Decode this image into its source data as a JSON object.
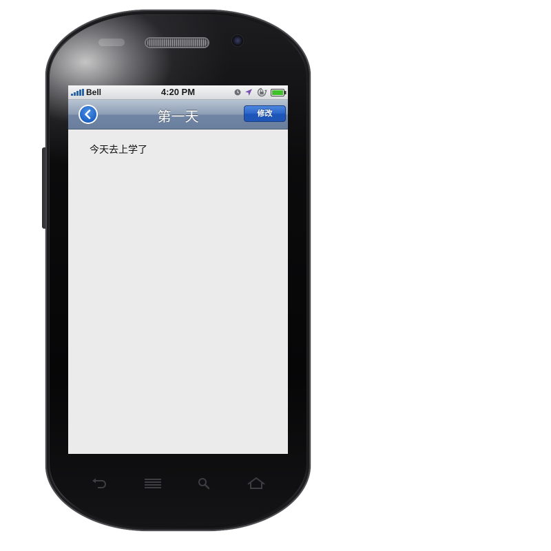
{
  "status_bar": {
    "carrier": "Bell",
    "time": "4:20 PM",
    "icons": [
      "clock-icon",
      "location-arrow-icon",
      "rotation-lock-icon",
      "battery-icon"
    ]
  },
  "nav_bar": {
    "back_icon": "chevron-left-circle-icon",
    "title": "第一天",
    "edit_label": "修改"
  },
  "content": {
    "text": "今天去上学了"
  },
  "hardware_keys": [
    "back-key-icon",
    "menu-key-icon",
    "search-key-icon",
    "home-key-icon"
  ],
  "colors": {
    "nav_bar": "#7186a4",
    "edit_button": "#2a64c8",
    "screen_background": "#ebebeb",
    "battery": "#3fbf2a"
  }
}
